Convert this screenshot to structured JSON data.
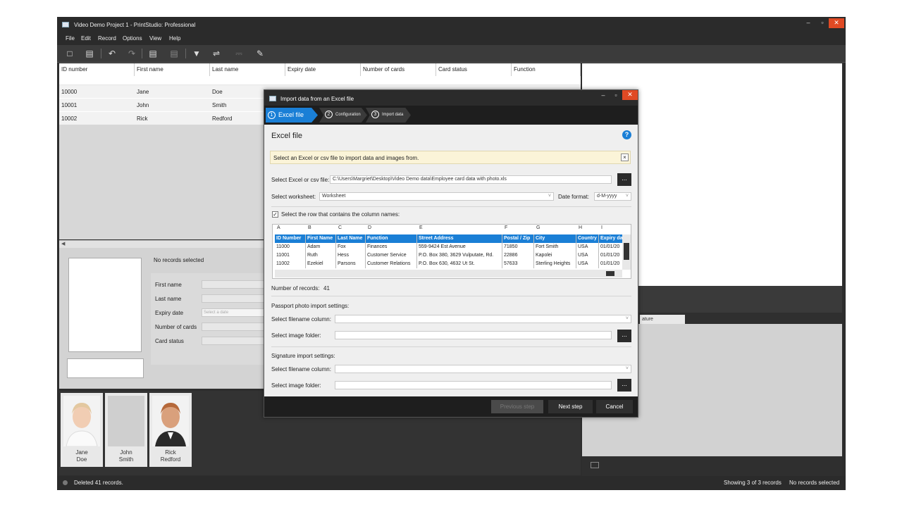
{
  "window": {
    "title": "Video Demo Project 1 - PrintStudio: Professional",
    "controls": {
      "minimize": "–",
      "maximize": "▫",
      "close": "✕"
    }
  },
  "menu": [
    "File",
    "Edit",
    "Record",
    "Options",
    "View",
    "Help"
  ],
  "toolbar_icons": [
    "new-record-icon",
    "open-folder-icon",
    "undo-icon",
    "redo-icon",
    "card-print-icon",
    "card-encode-icon",
    "filter-icon",
    "link-icon",
    "printer-icon",
    "edit-layout-icon"
  ],
  "grid": {
    "columns": [
      "ID number",
      "First name",
      "Last name",
      "Expiry date",
      "Number of cards",
      "Card status",
      "Function"
    ],
    "rows": [
      [
        "10000",
        "Jane",
        "Doe"
      ],
      [
        "10001",
        "John",
        "Smith"
      ],
      [
        "10002",
        "Rick",
        "Redford"
      ]
    ]
  },
  "details": {
    "no_records": "No records selected",
    "fields": [
      "First name",
      "Last name",
      "Expiry date",
      "Number of cards",
      "Card status"
    ],
    "expiry_placeholder": "Select a date"
  },
  "thumbnails": [
    {
      "first": "Jane",
      "last": "Doe"
    },
    {
      "first": "John",
      "last": "Smith"
    },
    {
      "first": "Rick",
      "last": "Redford"
    }
  ],
  "right_tab": "ature",
  "status": {
    "left": "Deleted 41 records.",
    "showing": "Showing 3 of 3 records",
    "selected": "No records selected"
  },
  "dialog": {
    "title": "Import data from an Excel file",
    "steps": [
      {
        "num": "1",
        "label": "Excel file"
      },
      {
        "num": "2",
        "label": "Configuration"
      },
      {
        "num": "3",
        "label": "Import data"
      }
    ],
    "heading": "Excel file",
    "help": "?",
    "info": "Select an Excel or csv file to import data and images from.",
    "file_label": "Select Excel or csv file:",
    "file_value": "C:\\Users\\Margriet\\Desktop\\Video Demo data\\Employee card data with photo.xls",
    "browse": "...",
    "worksheet_label": "Select worksheet:",
    "worksheet_value": "Worksheet",
    "date_format_label": "Date format:",
    "date_format_value": "d-M-yyyy",
    "header_row_label": "Select the row that contains the column names:",
    "preview": {
      "letters": [
        "A",
        "B",
        "C",
        "D",
        "E",
        "F",
        "G",
        "H",
        "I"
      ],
      "header": [
        "ID Number",
        "First Name",
        "Last Name",
        "Function",
        "Street Address",
        "Postal / Zip",
        "City",
        "Country",
        "Expiry da"
      ],
      "rows": [
        [
          "11000",
          "Adam",
          "Fox",
          "Finances",
          "559-9424 Est Avenue",
          "71850",
          "Fort Smith",
          "USA",
          "01/01/20"
        ],
        [
          "11001",
          "Ruth",
          "Hess",
          "Customer Service",
          "P.O. Box 380, 3629 Vulputate, Rd.",
          "22886",
          "Kapolei",
          "USA",
          "01/01/20"
        ],
        [
          "11002",
          "Ezekiel",
          "Parsons",
          "Customer Relations",
          "P.O. Box 630, 4632 Ut St.",
          "57633",
          "Sterling Heights",
          "USA",
          "01/01/20"
        ]
      ]
    },
    "records_label": "Number of records:",
    "records_value": "41",
    "passport_section": "Passport photo import settings:",
    "signature_section": "Signature import settings:",
    "filename_label": "Select filename column:",
    "folder_label": "Select image folder:",
    "buttons": {
      "previous": "Previous step",
      "next": "Next step",
      "cancel": "Cancel"
    }
  }
}
